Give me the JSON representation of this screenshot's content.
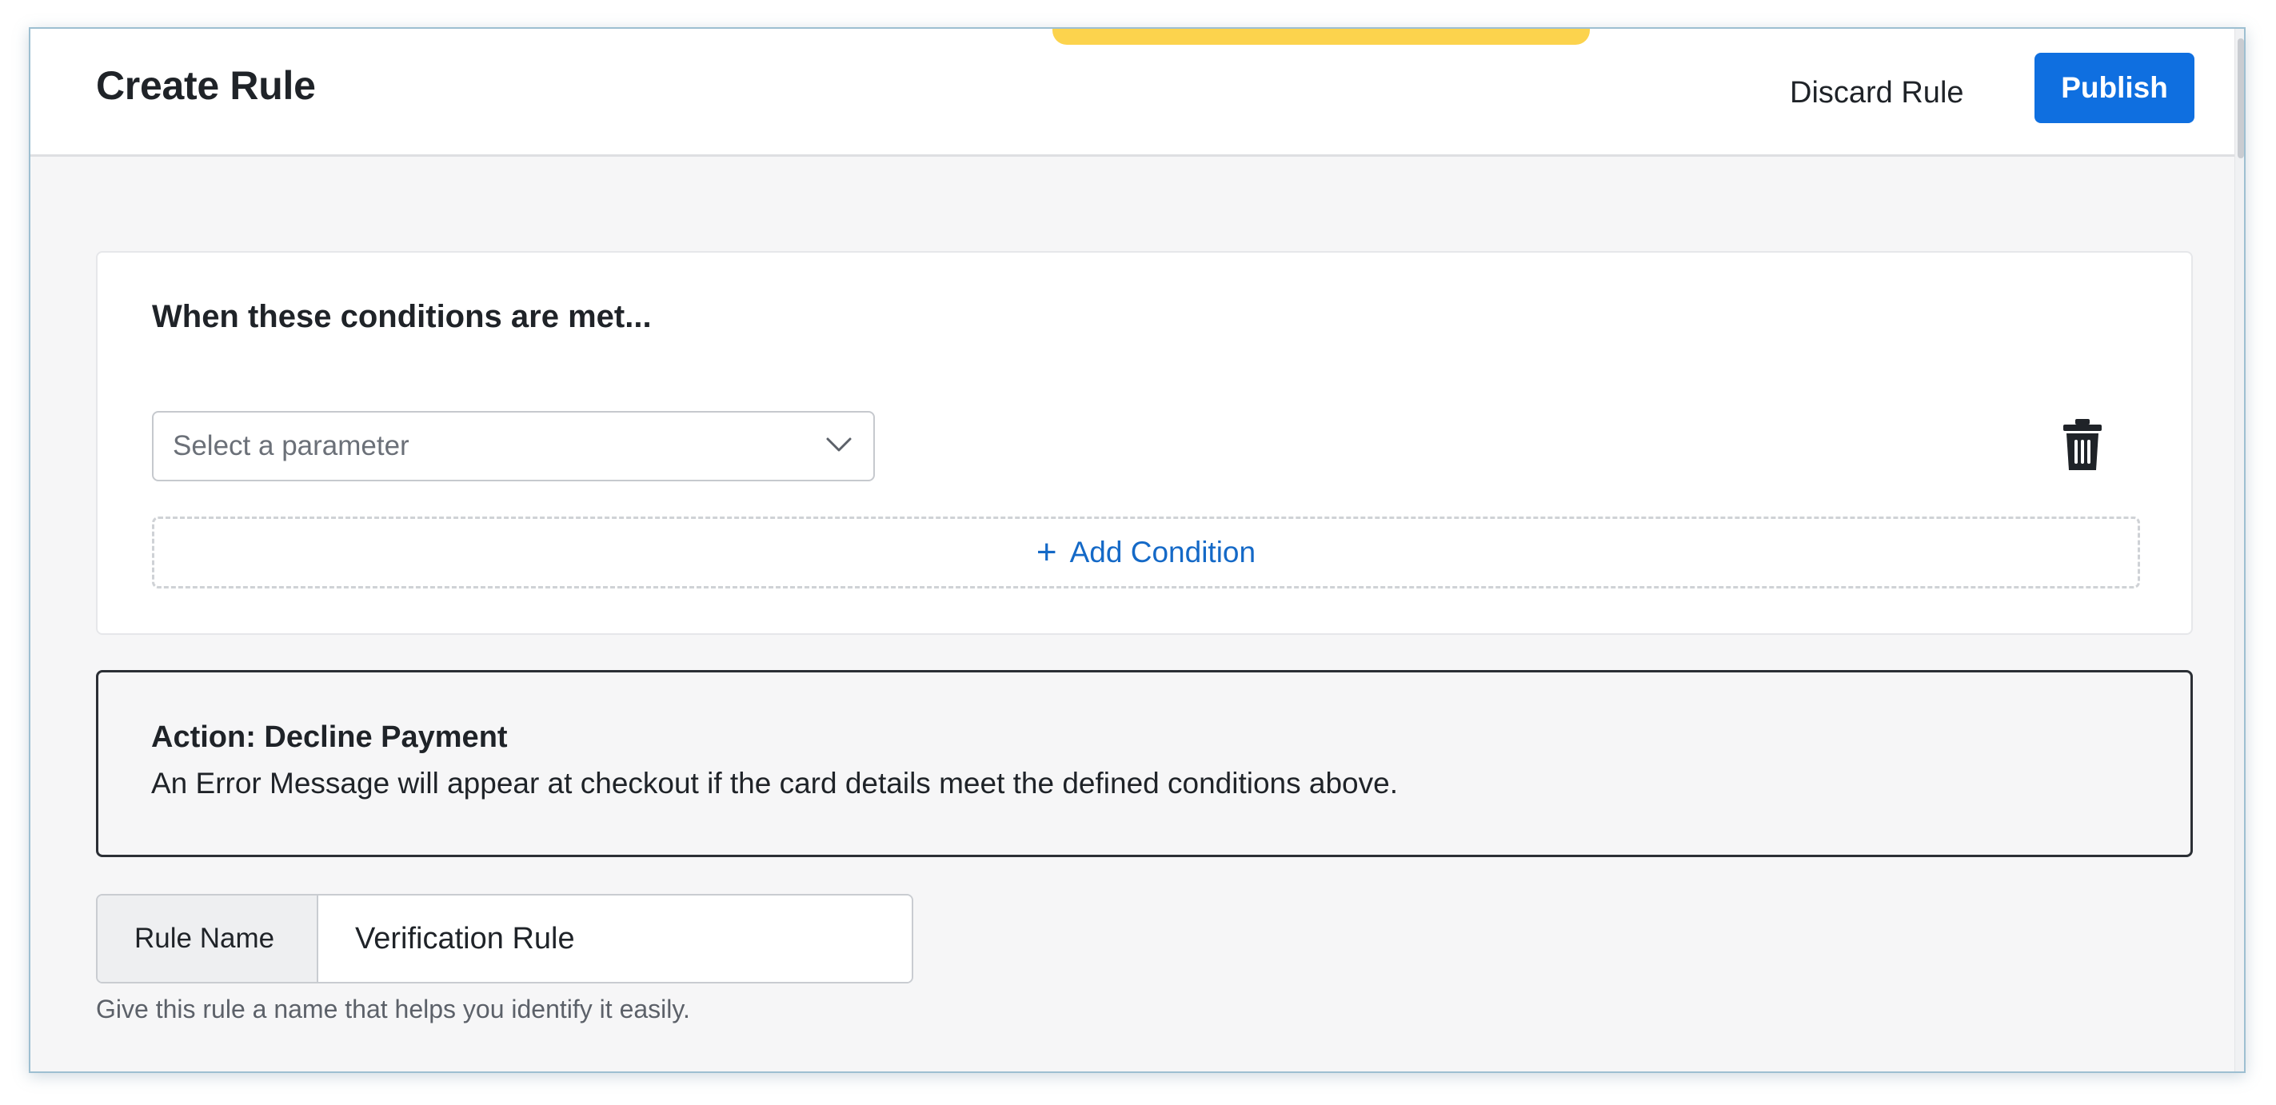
{
  "header": {
    "title": "Create Rule",
    "discard_label": "Discard Rule",
    "publish_label": "Publish"
  },
  "conditions": {
    "title": "When these conditions are met...",
    "parameter_placeholder": "Select a parameter",
    "add_condition_label": "Add Condition",
    "add_icon": "plus-icon",
    "delete_icon": "trash-icon"
  },
  "action": {
    "title": "Action: Decline Payment",
    "description": "An Error Message will appear at checkout if the card details meet the defined conditions above."
  },
  "rule_name": {
    "label": "Rule Name",
    "value": "Verification Rule",
    "helper": "Give this rule a name that helps you identify it easily."
  },
  "colors": {
    "primary": "#0f6fe0",
    "link": "#1469c7",
    "toast": "#fcd34d",
    "background": "#f6f6f7"
  }
}
